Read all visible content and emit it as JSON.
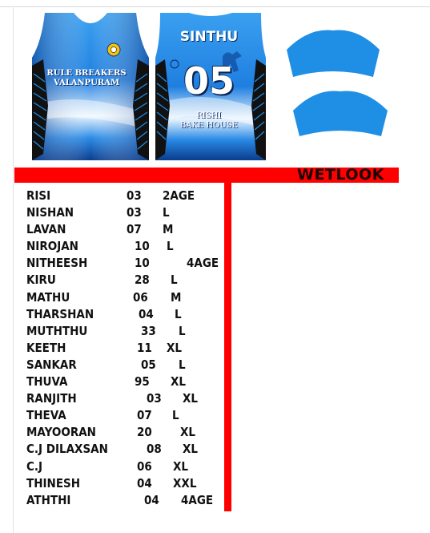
{
  "jersey": {
    "team_name_line1": "RULE BREAKERS",
    "team_name_line2": "VALANPURAM",
    "player_name": "SINTHU",
    "player_number": "05",
    "sponsor_line1": "RISHI",
    "sponsor_line2": "BAKE HOUSE",
    "colors": {
      "primary": "#1f8fe6",
      "light": "#e8f4ff",
      "dark": "#0a3c8c",
      "pattern": "#111111"
    }
  },
  "fabric_label": "WETLOOK",
  "accent_color": "#ff0000",
  "roster": [
    {
      "name": "RISI",
      "number": "03",
      "size": "2AGE"
    },
    {
      "name": "NISHAN",
      "number": "03",
      "size": "L"
    },
    {
      "name": "LAVAN",
      "number": "07",
      "size": "M"
    },
    {
      "name": "NIROJAN",
      "number": "10",
      "size": "L"
    },
    {
      "name": "NITHEESH",
      "number": "10",
      "size": "4AGE"
    },
    {
      "name": "KIRU",
      "number": "28",
      "size": "L"
    },
    {
      "name": "MATHU",
      "number": "06",
      "size": "M"
    },
    {
      "name": "THARSHAN",
      "number": "04",
      "size": "L"
    },
    {
      "name": "MUTHTHU",
      "number": "33",
      "size": "L"
    },
    {
      "name": "KEETH",
      "number": "11",
      "size": "XL"
    },
    {
      "name": "SANKAR",
      "number": "05",
      "size": "L"
    },
    {
      "name": "THUVA",
      "number": "95",
      "size": "XL"
    },
    {
      "name": "RANJITH",
      "number": "03",
      "size": "XL"
    },
    {
      "name": "THEVA",
      "number": "07",
      "size": "L"
    },
    {
      "name": "MAYOORAN",
      "number": "20",
      "size": "XL"
    },
    {
      "name": "C.J DILAXSAN",
      "number": "08",
      "size": "XL"
    },
    {
      "name": "C.J",
      "number": "06",
      "size": "XL"
    },
    {
      "name": "THINESH",
      "number": "04",
      "size": "XXL"
    },
    {
      "name": "ATHTHI",
      "number": "04",
      "size": "4AGE"
    }
  ]
}
